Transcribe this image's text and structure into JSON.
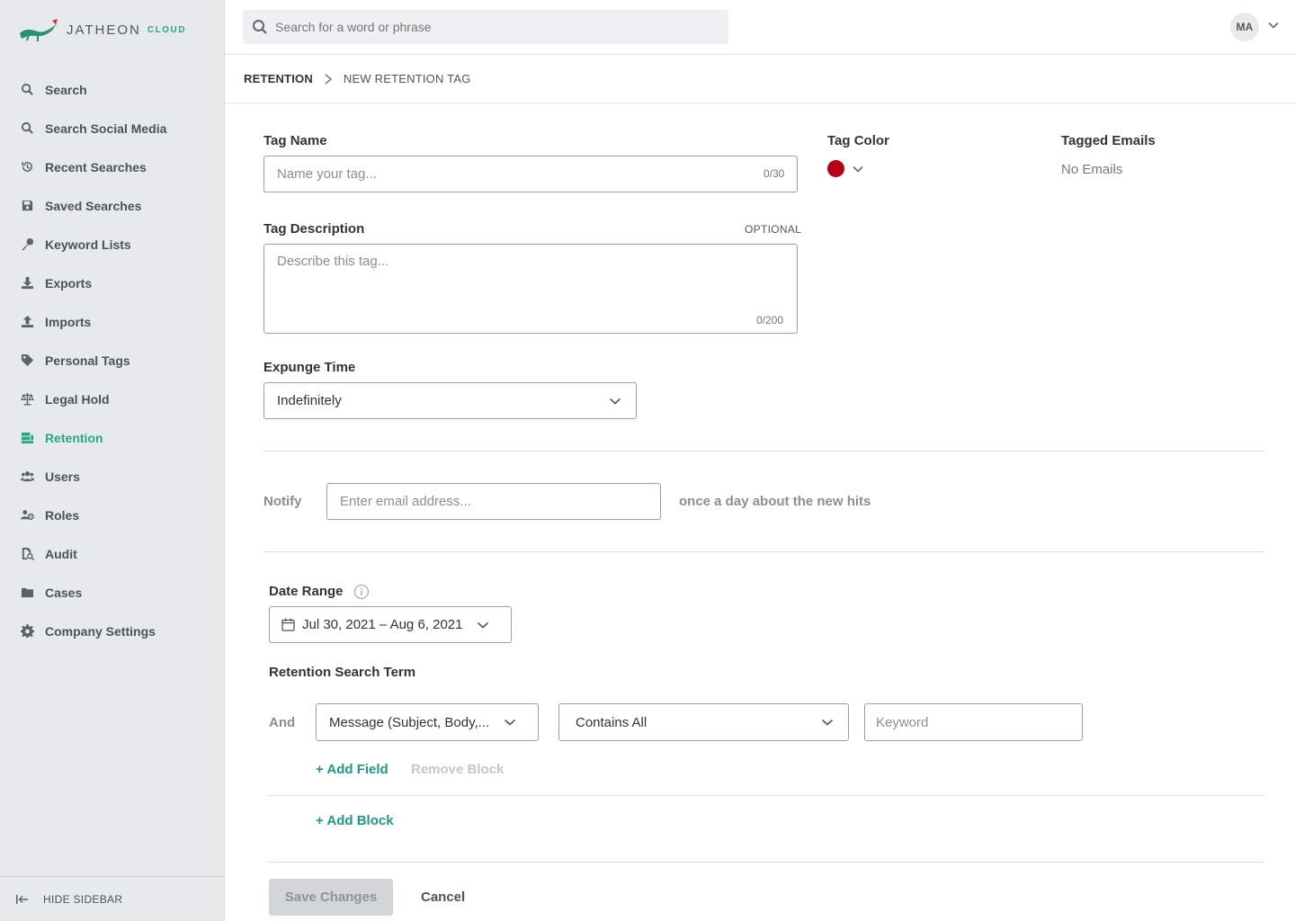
{
  "app": {
    "logo_text": "JATHEON",
    "logo_sub": "CLOUD"
  },
  "search": {
    "placeholder": "Search for a word or phrase"
  },
  "user": {
    "initials": "MA"
  },
  "sidebar": {
    "items": [
      {
        "label": "Search",
        "icon": "search-icon"
      },
      {
        "label": "Search Social Media",
        "icon": "search-icon"
      },
      {
        "label": "Recent Searches",
        "icon": "history-icon"
      },
      {
        "label": "Saved Searches",
        "icon": "save-icon"
      },
      {
        "label": "Keyword Lists",
        "icon": "key-icon"
      },
      {
        "label": "Exports",
        "icon": "download-icon"
      },
      {
        "label": "Imports",
        "icon": "upload-icon"
      },
      {
        "label": "Personal Tags",
        "icon": "tag-icon"
      },
      {
        "label": "Legal Hold",
        "icon": "scale-icon"
      },
      {
        "label": "Retention",
        "icon": "archive-icon",
        "active": true
      },
      {
        "label": "Users",
        "icon": "users-icon"
      },
      {
        "label": "Roles",
        "icon": "roles-icon"
      },
      {
        "label": "Audit",
        "icon": "audit-icon"
      },
      {
        "label": "Cases",
        "icon": "folder-icon"
      },
      {
        "label": "Company Settings",
        "icon": "gear-icon"
      }
    ],
    "hide_label": "HIDE SIDEBAR"
  },
  "breadcrumb": {
    "parent": "RETENTION",
    "current": "NEW RETENTION TAG"
  },
  "form": {
    "tag_name": {
      "label": "Tag Name",
      "placeholder": "Name your tag...",
      "counter": "0/30"
    },
    "tag_color": {
      "label": "Tag Color",
      "value": "#b5001a"
    },
    "tagged_emails": {
      "label": "Tagged Emails",
      "value": "No Emails"
    },
    "tag_description": {
      "label": "Tag Description",
      "optional": "OPTIONAL",
      "placeholder": "Describe this tag...",
      "counter": "0/200"
    },
    "expunge_time": {
      "label": "Expunge Time",
      "value": "Indefinitely"
    },
    "notify": {
      "label": "Notify",
      "placeholder": "Enter email address...",
      "suffix": "once a day about the new hits"
    },
    "date_range": {
      "label": "Date Range",
      "value": "Jul 30, 2021 – Aug 6, 2021"
    },
    "retention_search_term": {
      "label": "Retention Search Term",
      "operator": "And",
      "field": "Message (Subject, Body,...",
      "condition": "Contains All",
      "keyword_placeholder": "Keyword",
      "add_field": "+ Add Field",
      "remove_block": "Remove Block",
      "add_block": "+ Add Block"
    },
    "save_label": "Save Changes",
    "cancel_label": "Cancel"
  },
  "colors": {
    "accent": "#2aa58a",
    "sidebar_bg": "#e6eaeb",
    "tag_red": "#b5001a"
  }
}
